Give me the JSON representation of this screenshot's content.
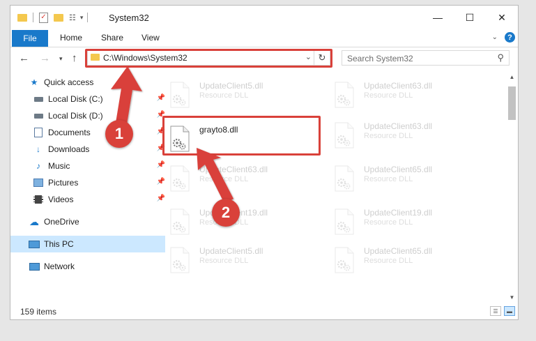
{
  "window": {
    "title": "System32",
    "controls": {
      "minimize": "—",
      "maximize": "☐",
      "close": "✕"
    }
  },
  "quick_access_toolbar": [
    "folder-icon",
    "properties-icon",
    "new-folder-icon",
    "view-icon",
    "dropdown-icon"
  ],
  "ribbon": {
    "tabs": [
      "File",
      "Home",
      "Share",
      "View"
    ],
    "help_label": "?"
  },
  "address": {
    "path": "C:\\Windows\\System32"
  },
  "search": {
    "placeholder": "Search System32"
  },
  "sidebar": {
    "items": [
      {
        "label": "Quick access",
        "icon": "star-icon",
        "pinned": false
      },
      {
        "label": "Local Disk (C:)",
        "icon": "drive-icon",
        "pinned": true
      },
      {
        "label": "Local Disk (D:)",
        "icon": "drive-icon",
        "pinned": true
      },
      {
        "label": "Documents",
        "icon": "documents-icon",
        "pinned": true
      },
      {
        "label": "Downloads",
        "icon": "download-icon",
        "pinned": true
      },
      {
        "label": "Music",
        "icon": "music-icon",
        "pinned": true
      },
      {
        "label": "Pictures",
        "icon": "pictures-icon",
        "pinned": true
      },
      {
        "label": "Videos",
        "icon": "videos-icon",
        "pinned": true
      },
      {
        "label": "OneDrive",
        "icon": "cloud-icon",
        "pinned": false
      },
      {
        "label": "This PC",
        "icon": "computer-icon",
        "pinned": false,
        "selected": true
      },
      {
        "label": "Network",
        "icon": "network-icon",
        "pinned": false
      }
    ]
  },
  "files": {
    "left": [
      {
        "name": "UpdateClient5.dll",
        "type": "Resource DLL",
        "faded": true
      },
      {
        "name": "grayto8.dll",
        "type": "",
        "faded": false,
        "highlighted": true
      },
      {
        "name": "UpdateClient63.dll",
        "type": "Resource DLL",
        "faded": true
      },
      {
        "name": "UpdateClient19.dll",
        "type": "Resource DLL",
        "faded": true
      },
      {
        "name": "UpdateClient5.dll",
        "type": "Resource DLL",
        "faded": true
      }
    ],
    "right": [
      {
        "name": "UpdateClient63.dll",
        "type": "Resource DLL",
        "faded": true
      },
      {
        "name": "UpdateClient63.dll",
        "type": "Resource DLL",
        "faded": true
      },
      {
        "name": "UpdateClient65.dll",
        "type": "Resource DLL",
        "faded": true
      },
      {
        "name": "UpdateClient19.dll",
        "type": "Resource DLL",
        "faded": true
      },
      {
        "name": "UpdateClient65.dll",
        "type": "Resource DLL",
        "faded": true
      }
    ]
  },
  "status": {
    "item_count": "159 items"
  },
  "annotations": {
    "step1": "1",
    "step2": "2",
    "highlight_color": "#d9413a"
  },
  "colors": {
    "accent": "#1979ca",
    "selection": "#cce8ff",
    "annotation": "#d9413a"
  }
}
